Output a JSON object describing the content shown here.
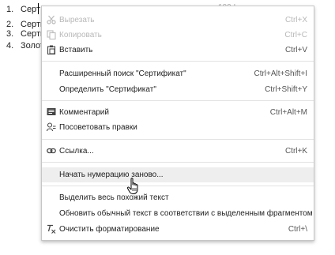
{
  "document": {
    "lines": [
      {
        "num": "1.",
        "text": "Серт"
      },
      {
        "num": "2.",
        "text": "Серти"
      },
      {
        "num": "3.",
        "text": "Серти"
      },
      {
        "num": "4.",
        "text": "Золот"
      }
    ],
    "faint": "100 !"
  },
  "menu": {
    "cut": {
      "label": "Вырезать",
      "shortcut": "Ctrl+X",
      "icon": "scissors-icon",
      "enabled": false
    },
    "copy": {
      "label": "Копировать",
      "shortcut": "Ctrl+C",
      "icon": "copy-icon",
      "enabled": false
    },
    "paste": {
      "label": "Вставить",
      "shortcut": "Ctrl+V",
      "icon": "clipboard-icon"
    },
    "search": {
      "label": "Расширенный поиск \"Сертификат\"",
      "shortcut": "Ctrl+Alt+Shift+I"
    },
    "define": {
      "label": "Определить \"Сертификат\"",
      "shortcut": "Ctrl+Shift+Y"
    },
    "comment": {
      "label": "Комментарий",
      "shortcut": "Ctrl+Alt+M",
      "icon": "comment-icon"
    },
    "suggest": {
      "label": "Посоветовать правки",
      "icon": "suggest-edits-icon"
    },
    "link": {
      "label": "Ссылка...",
      "shortcut": "Ctrl+K",
      "icon": "link-icon"
    },
    "restart": {
      "label": "Начать нумерацию заново...",
      "hovered": true
    },
    "select_similar": {
      "label": "Выделить весь похожий текст"
    },
    "update_style": {
      "label": "Обновить обычный текст в соответствии с выделенным фрагментом"
    },
    "clear_format": {
      "label": "Очистить форматирование",
      "shortcut": "Ctrl+\\",
      "icon": "clear-formatting-icon"
    }
  }
}
